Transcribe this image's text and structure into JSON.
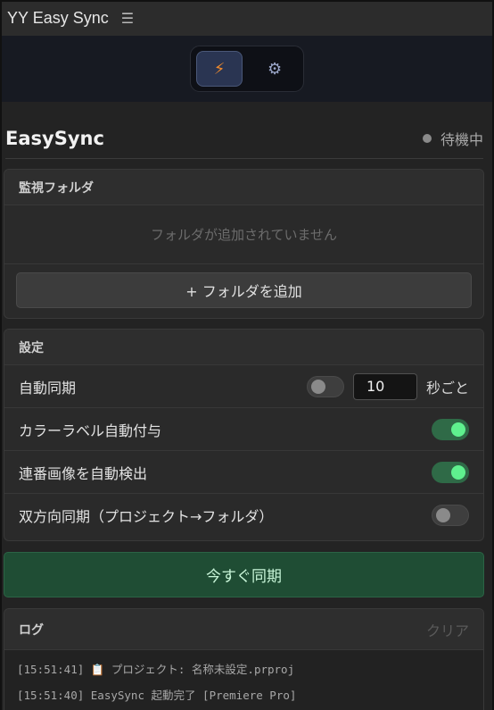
{
  "window": {
    "title": "YY Easy Sync",
    "menu_icon": "hamburger-icon"
  },
  "modes": [
    {
      "name": "sync-mode",
      "icon": "lightning-icon",
      "glyph": "⚡",
      "active": true
    },
    {
      "name": "settings-mode",
      "icon": "gear-icon",
      "glyph": "⚙",
      "active": false
    }
  ],
  "header": {
    "title": "EasySync",
    "status": "待機中"
  },
  "folders": {
    "heading": "監視フォルダ",
    "empty": "フォルダが追加されていません",
    "add_label": "+ フォルダを追加"
  },
  "settings": {
    "heading": "設定",
    "auto_sync": {
      "label": "自動同期",
      "enabled": false,
      "interval": "10",
      "unit": "秒ごと"
    },
    "color_label": {
      "label": "カラーラベル自動付与",
      "enabled": true
    },
    "sequence": {
      "label": "連番画像を自動検出",
      "enabled": true
    },
    "bidirectional": {
      "label": "双方向同期（プロジェクト→フォルダ）",
      "enabled": false
    }
  },
  "sync_now": "今すぐ同期",
  "log": {
    "heading": "ログ",
    "clear": "クリア",
    "lines": [
      "[15:51:41] 📋 プロジェクト: 名称未設定.prproj",
      "[15:51:40] EasySync 起動完了 [Premiere Pro]"
    ]
  },
  "colors": {
    "accent_green": "#5ff08e",
    "sync_button": "#1f4d34",
    "mode_active_icon": "#f08a2c"
  }
}
